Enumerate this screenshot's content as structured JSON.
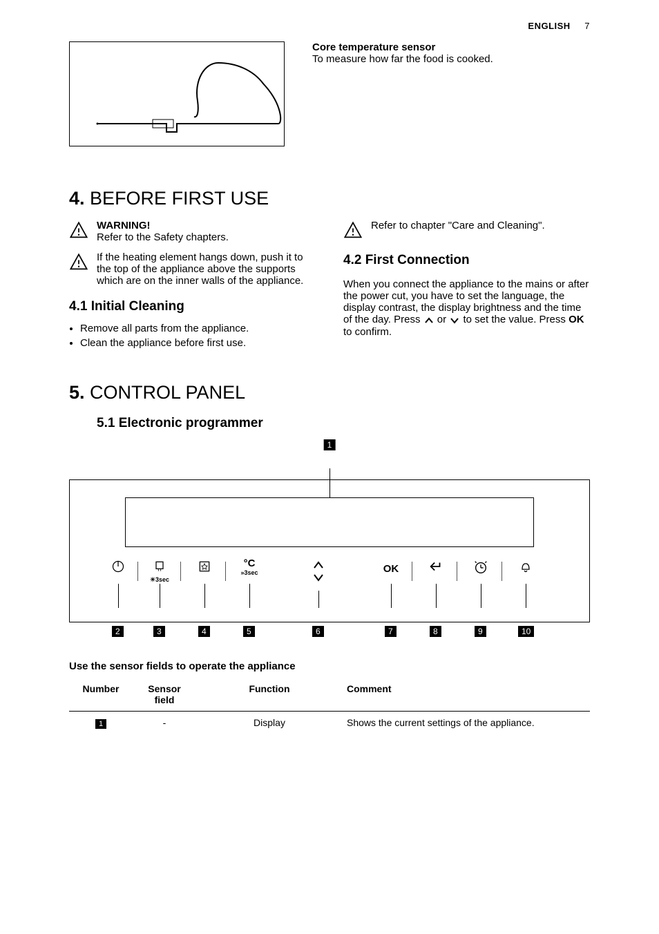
{
  "header": {
    "language": "ENGLISH",
    "page_number": "7"
  },
  "accessory": {
    "title": "Core temperature sensor",
    "desc": "To measure how far the food is cooked."
  },
  "section4": {
    "number": "4.",
    "title": "BEFORE FIRST USE",
    "warning_bold": "WARNING!",
    "warning_text": "Refer to the Safety chapters.",
    "note1": "If the heating element hangs down, push it to the top of the appliance above the supports which are on the inner walls of the appliance.",
    "sub1_num": "4.1",
    "sub1_title": "Initial Cleaning",
    "bullets": [
      "Remove all parts from the appliance.",
      "Clean the appliance before first use."
    ],
    "note2": "Refer to chapter \"Care and Cleaning\".",
    "sub2_num": "4.2",
    "sub2_title": "First Connection",
    "body2_a": "When you connect the appliance to the mains or after the power cut, you have to set the language, the display contrast, the display brightness and the time of the day. Press ",
    "body2_b": " or ",
    "body2_c": " to set the value. Press ",
    "ok_text": "OK",
    "body2_d": " to confirm."
  },
  "section5": {
    "number": "5.",
    "title": "CONTROL PANEL",
    "sub1_num": "5.1",
    "sub1_title": "Electronic programmer",
    "callouts": [
      "1",
      "2",
      "3",
      "4",
      "5",
      "6",
      "7",
      "8",
      "9",
      "10"
    ],
    "panel_items": {
      "ok": "OK",
      "degc": "°C",
      "light_sub": "3sec",
      "degc_sub": "3sec"
    },
    "table_caption": "Use the sensor fields to operate the appliance",
    "table": {
      "headers": [
        "Number",
        "Sensor field",
        "Function",
        "Comment"
      ],
      "rows": [
        {
          "num": "1",
          "sensor": "-",
          "function": "Display",
          "comment": "Shows the current settings of the appliance."
        }
      ]
    }
  }
}
